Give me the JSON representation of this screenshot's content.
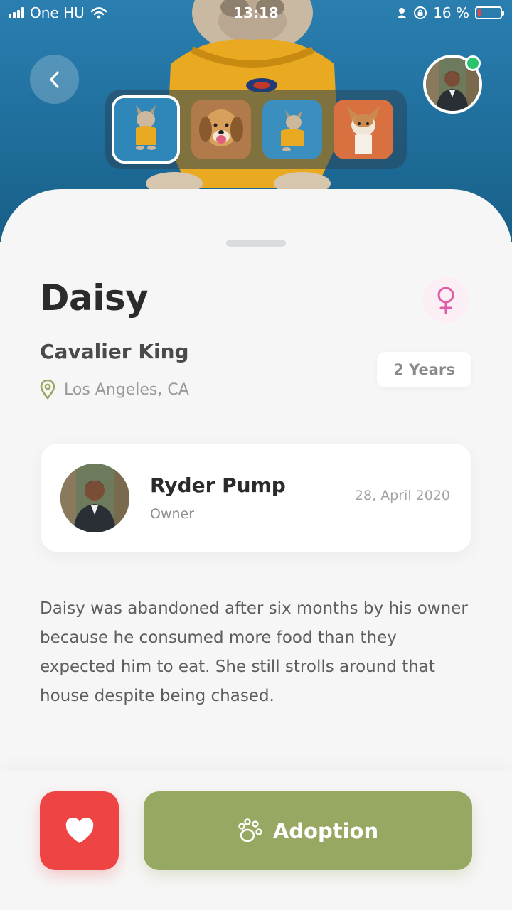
{
  "status_bar": {
    "carrier": "One HU",
    "time": "13:18",
    "battery_percent": "16 %",
    "battery_level": 0.16
  },
  "hero": {
    "back_icon": "chevron-left-icon",
    "owner_online": true,
    "thumbnails": [
      {
        "name": "french-bulldog-yellow-shirt",
        "active": true
      },
      {
        "name": "beagle-smiling",
        "active": false
      },
      {
        "name": "french-bulldog-yellow-shirt-2",
        "active": false
      },
      {
        "name": "corgi-puppy",
        "active": false
      }
    ]
  },
  "pet": {
    "name": "Daisy",
    "gender_icon": "female-icon",
    "breed": "Cavalier King",
    "age": "2 Years",
    "location": "Los Angeles, CA",
    "description": "Daisy was abandoned after six months by his owner because he consumed more food than they expected him to eat. She still strolls around that house despite being chased."
  },
  "owner": {
    "name": "Ryder Pump",
    "role": "Owner",
    "date": "28, April 2020"
  },
  "actions": {
    "favorite_icon": "heart-icon",
    "adopt_label": "Adoption",
    "adopt_icon": "paw-icon"
  },
  "colors": {
    "accent_green": "#96a862",
    "favorite_red": "#ef4444",
    "female_pink": "#e05ca6",
    "online_green": "#28c46e"
  }
}
